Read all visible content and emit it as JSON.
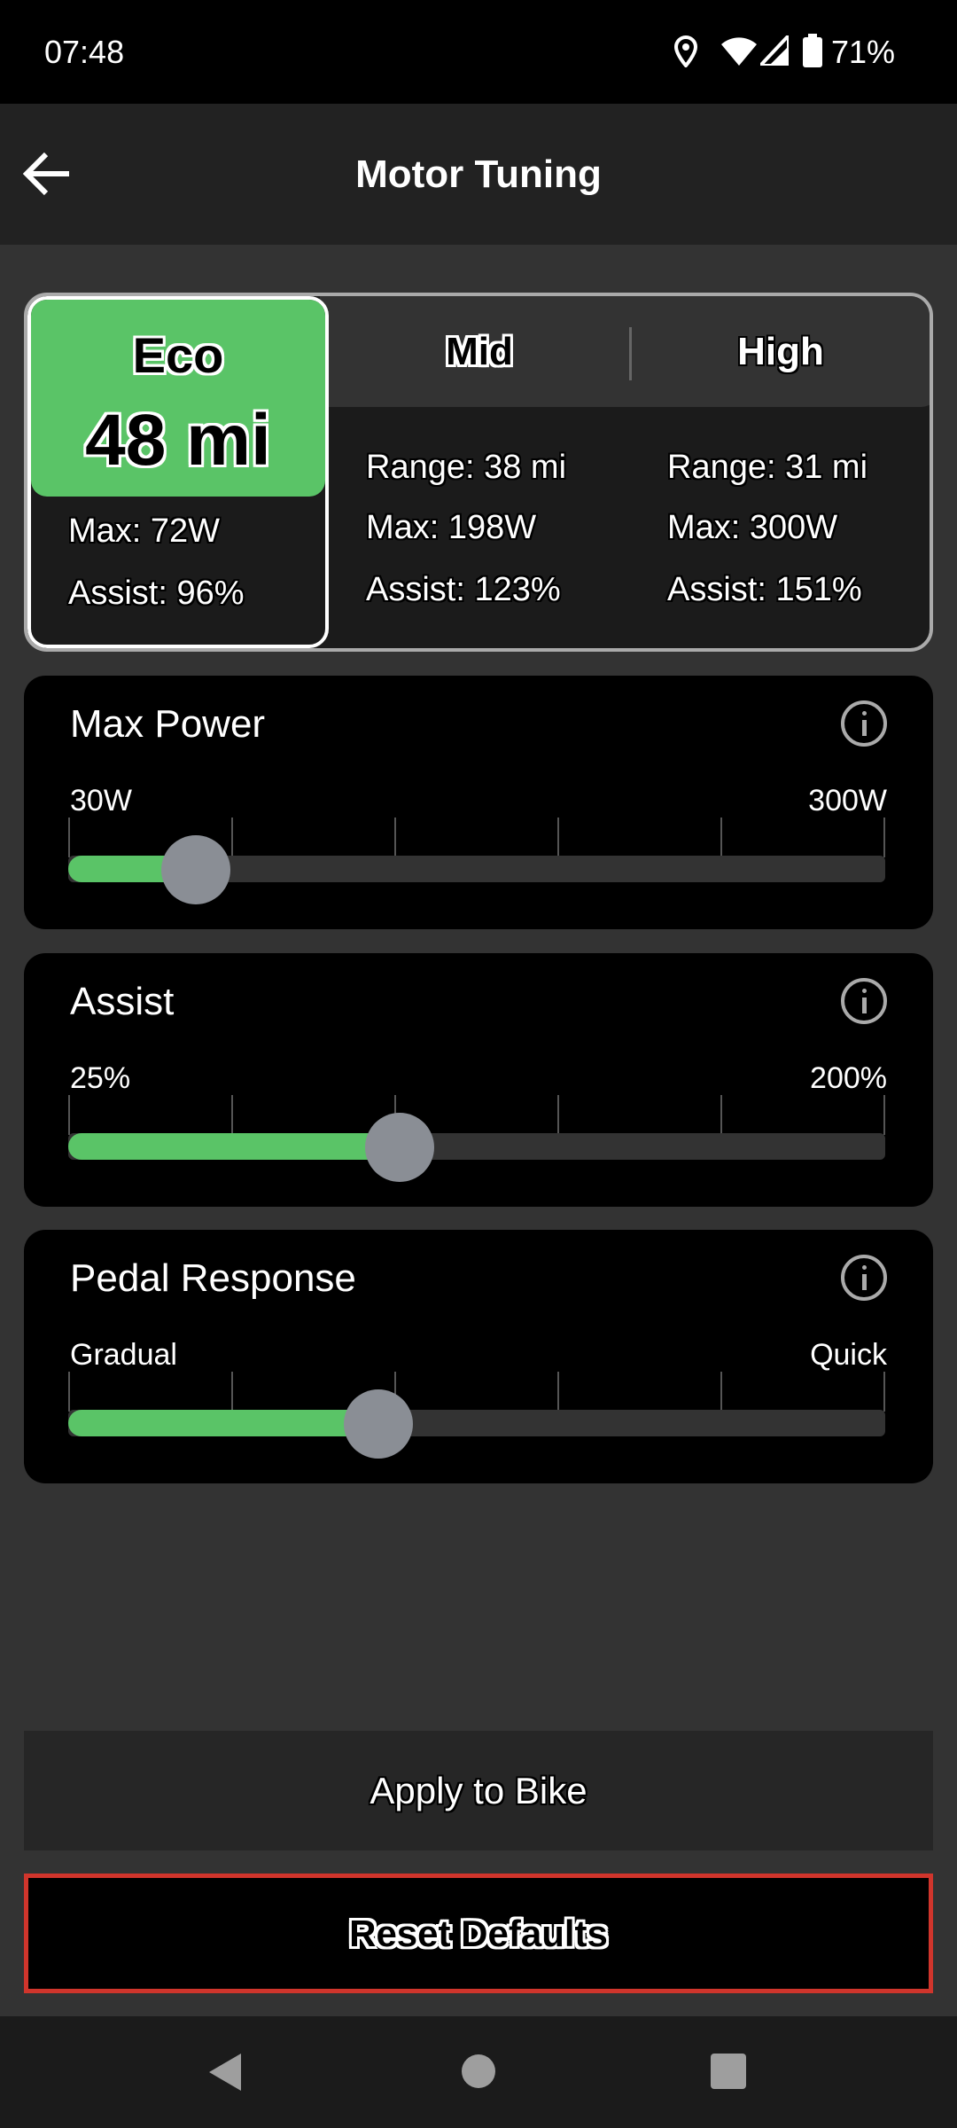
{
  "status_bar": {
    "time": "07:48",
    "battery": "71%"
  },
  "header": {
    "title": "Motor Tuning",
    "back_icon": "arrow-left-icon"
  },
  "modes": [
    {
      "label": "Eco",
      "range": "48 mi",
      "max": "Max: 72W",
      "assist": "Assist: 96%",
      "selected": true
    },
    {
      "label": "Mid",
      "range": "Range: 38 mi",
      "max": "Max: 198W",
      "assist": "Assist: 123%",
      "selected": false
    },
    {
      "label": "High",
      "range": "Range: 31 mi",
      "max": "Max: 300W",
      "assist": "Assist: 151%",
      "selected": false
    }
  ],
  "sliders": [
    {
      "title": "Max Power",
      "min_label": "30W",
      "max_label": "300W",
      "value_fraction": 0.156
    },
    {
      "title": "Assist",
      "min_label": "25%",
      "max_label": "200%",
      "value_fraction": 0.406
    },
    {
      "title": "Pedal Response",
      "min_label": "Gradual",
      "max_label": "Quick",
      "value_fraction": 0.38
    }
  ],
  "buttons": {
    "apply": "Apply to Bike",
    "reset": "Reset Defaults"
  },
  "colors": {
    "accent": "#5ac467",
    "reset_border": "#d0352c",
    "thumb": "#8a8e95"
  }
}
